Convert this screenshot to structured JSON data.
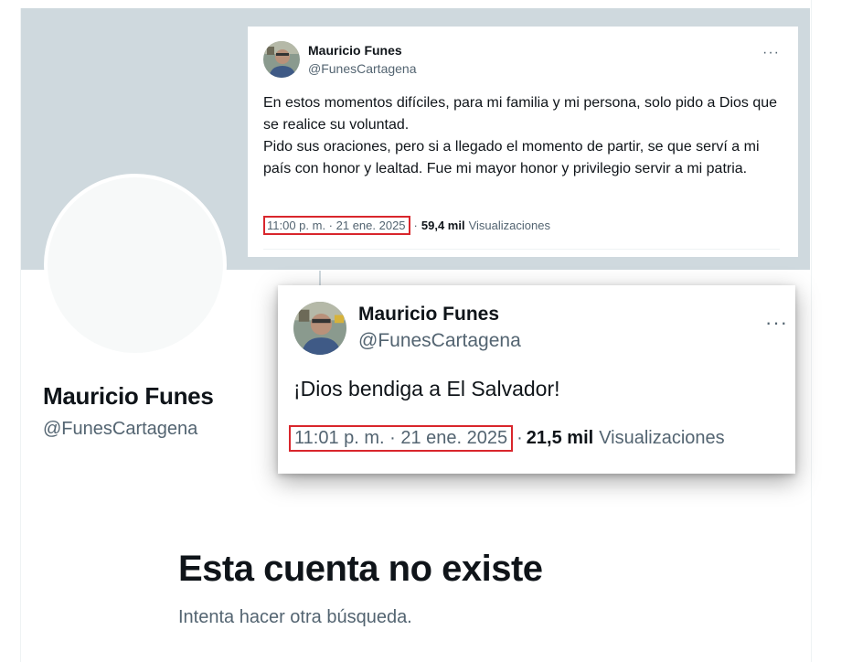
{
  "profile": {
    "name": "Mauricio Funes",
    "handle": "@FunesCartagena"
  },
  "empty_state": {
    "title": "Esta cuenta no existe",
    "subtitle": "Intenta hacer otra búsqueda."
  },
  "tweet1": {
    "author_name": "Mauricio Funes",
    "author_handle": "@FunesCartagena",
    "more_label": "···",
    "text_lines": [
      "En estos momentos difíciles, para mi familia y mi persona, solo pido a Dios que se realice su voluntad.",
      "Pido sus oraciones, pero si a llegado el momento de partir, se que serví a mi país con honor y lealtad. Fue mi mayor honor y privilegio servir a mi patria."
    ],
    "timestamp": "11:00 p. m. · 21 ene. 2025",
    "separator": "·",
    "views_count": "59,4 mil",
    "views_label": "Visualizaciones"
  },
  "tweet2": {
    "author_name": "Mauricio Funes",
    "author_handle": "@FunesCartagena",
    "more_label": "···",
    "text": "¡Dios bendiga a El Salvador!",
    "timestamp": "11:01 p. m. · 21 ene. 2025",
    "separator": "·",
    "views_count": "21,5 mil",
    "views_label": "Visualizaciones"
  },
  "colors": {
    "banner": "#cfd9de",
    "highlight_box": "#d9262c",
    "secondary_text": "#536471",
    "primary_text": "#0f1419"
  }
}
